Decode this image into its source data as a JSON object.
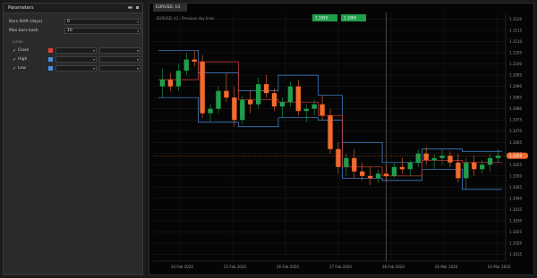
{
  "panel": {
    "title": "Parameters",
    "params": [
      {
        "label": "Bars Shift (days)",
        "value": "0"
      },
      {
        "label": "Max bars back",
        "value": "10"
      }
    ],
    "group": "Lines",
    "lines": [
      {
        "name": "Close",
        "color": "#e04040"
      },
      {
        "name": "High",
        "color": "#4a8fe0"
      },
      {
        "name": "Low",
        "color": "#4a8fe0"
      }
    ]
  },
  "chart": {
    "tab": "EURUSD, h1",
    "legend": "EURUSD, h1 · Previous day lines",
    "buy_price": "1.1060",
    "sell_price": "1.1059",
    "current_price": "1.1059",
    "x_labels": [
      "24 Feb 2020",
      "25 Feb 2020",
      "26 Feb 2020",
      "27 Feb 2020",
      "28 Feb 2020",
      "02 Mar 2020",
      "03 Mar 2020"
    ],
    "y_labels": [
      "1.1120",
      "1.1115",
      "1.1110",
      "1.1105",
      "1.1100",
      "1.1095",
      "1.1090",
      "1.1085",
      "1.1080",
      "1.1075",
      "1.1070",
      "1.1065",
      "1.1060",
      "1.1055",
      "1.1050",
      "1.1045",
      "1.1040",
      "1.1035",
      "1.1030",
      "1.1025",
      "1.1020",
      "1.1015"
    ],
    "colors": {
      "bull": "#1f9e4c",
      "bear": "#f26a2e",
      "line_close": "#e04040",
      "line_hl": "#4a8fe0",
      "price_tag": "#f26a2e"
    }
  },
  "chart_data": {
    "type": "candlestick",
    "candles": [
      {
        "o": 1.109,
        "h": 1.1098,
        "l": 1.1085,
        "c": 1.1093
      },
      {
        "o": 1.1093,
        "h": 1.1096,
        "l": 1.1088,
        "c": 1.109
      },
      {
        "o": 1.109,
        "h": 1.11,
        "l": 1.1088,
        "c": 1.1097
      },
      {
        "o": 1.1097,
        "h": 1.1105,
        "l": 1.1095,
        "c": 1.1102
      },
      {
        "o": 1.1102,
        "h": 1.1106,
        "l": 1.1099,
        "c": 1.1101
      },
      {
        "o": 1.1101,
        "h": 1.1104,
        "l": 1.1076,
        "c": 1.1078
      },
      {
        "o": 1.1078,
        "h": 1.1082,
        "l": 1.1074,
        "c": 1.108
      },
      {
        "o": 1.108,
        "h": 1.109,
        "l": 1.1078,
        "c": 1.1088
      },
      {
        "o": 1.1088,
        "h": 1.1096,
        "l": 1.1083,
        "c": 1.1085
      },
      {
        "o": 1.1085,
        "h": 1.109,
        "l": 1.1072,
        "c": 1.1075
      },
      {
        "o": 1.1075,
        "h": 1.1086,
        "l": 1.1073,
        "c": 1.1084
      },
      {
        "o": 1.1084,
        "h": 1.1088,
        "l": 1.1078,
        "c": 1.1082
      },
      {
        "o": 1.1082,
        "h": 1.1094,
        "l": 1.108,
        "c": 1.1091
      },
      {
        "o": 1.1091,
        "h": 1.1095,
        "l": 1.1085,
        "c": 1.1087
      },
      {
        "o": 1.1087,
        "h": 1.1089,
        "l": 1.1079,
        "c": 1.1081
      },
      {
        "o": 1.1081,
        "h": 1.1085,
        "l": 1.1076,
        "c": 1.1083
      },
      {
        "o": 1.1083,
        "h": 1.1092,
        "l": 1.1081,
        "c": 1.109
      },
      {
        "o": 1.109,
        "h": 1.1093,
        "l": 1.1077,
        "c": 1.1079
      },
      {
        "o": 1.1079,
        "h": 1.1082,
        "l": 1.1074,
        "c": 1.108
      },
      {
        "o": 1.108,
        "h": 1.1084,
        "l": 1.1077,
        "c": 1.1082
      },
      {
        "o": 1.1082,
        "h": 1.1086,
        "l": 1.1075,
        "c": 1.1077
      },
      {
        "o": 1.1077,
        "h": 1.108,
        "l": 1.106,
        "c": 1.1062
      },
      {
        "o": 1.1062,
        "h": 1.1065,
        "l": 1.1051,
        "c": 1.1054
      },
      {
        "o": 1.1054,
        "h": 1.106,
        "l": 1.105,
        "c": 1.1058
      },
      {
        "o": 1.1058,
        "h": 1.1062,
        "l": 1.1049,
        "c": 1.1052
      },
      {
        "o": 1.1052,
        "h": 1.1056,
        "l": 1.1048,
        "c": 1.105
      },
      {
        "o": 1.105,
        "h": 1.1054,
        "l": 1.1046,
        "c": 1.1049
      },
      {
        "o": 1.1049,
        "h": 1.1053,
        "l": 1.1047,
        "c": 1.1051
      },
      {
        "o": 1.1051,
        "h": 1.1055,
        "l": 1.1048,
        "c": 1.105
      },
      {
        "o": 1.105,
        "h": 1.1056,
        "l": 1.1049,
        "c": 1.1054
      },
      {
        "o": 1.1054,
        "h": 1.1058,
        "l": 1.1051,
        "c": 1.1053
      },
      {
        "o": 1.1053,
        "h": 1.1057,
        "l": 1.105,
        "c": 1.1056
      },
      {
        "o": 1.1056,
        "h": 1.1062,
        "l": 1.1054,
        "c": 1.106
      },
      {
        "o": 1.106,
        "h": 1.1063,
        "l": 1.1055,
        "c": 1.1057
      },
      {
        "o": 1.1057,
        "h": 1.106,
        "l": 1.1053,
        "c": 1.1058
      },
      {
        "o": 1.1058,
        "h": 1.1062,
        "l": 1.1055,
        "c": 1.1059
      },
      {
        "o": 1.1059,
        "h": 1.1061,
        "l": 1.1054,
        "c": 1.1056
      },
      {
        "o": 1.1056,
        "h": 1.106,
        "l": 1.1047,
        "c": 1.1049
      },
      {
        "o": 1.1049,
        "h": 1.1058,
        "l": 1.1044,
        "c": 1.1056
      },
      {
        "o": 1.1056,
        "h": 1.1059,
        "l": 1.105,
        "c": 1.1053
      },
      {
        "o": 1.1053,
        "h": 1.1057,
        "l": 1.1051,
        "c": 1.1055
      },
      {
        "o": 1.1055,
        "h": 1.106,
        "l": 1.1052,
        "c": 1.1058
      },
      {
        "o": 1.1058,
        "h": 1.1062,
        "l": 1.1056,
        "c": 1.1059
      }
    ],
    "close_line": [
      1.1093,
      1.1093,
      1.1093,
      1.1093,
      1.1093,
      1.1101,
      1.1101,
      1.1101,
      1.1101,
      1.1101,
      1.1084,
      1.1084,
      1.1084,
      1.1084,
      1.1084,
      1.1083,
      1.1083,
      1.1083,
      1.1083,
      1.1083,
      1.1077,
      1.1077,
      1.1077,
      1.1054,
      1.1054,
      1.1054,
      1.1054,
      1.1054,
      1.105,
      1.105,
      1.105,
      1.105,
      1.105,
      1.1057,
      1.1057,
      1.1057,
      1.1057,
      1.1057,
      1.1056,
      1.1056,
      1.1056,
      1.1056,
      1.1056
    ],
    "high_line": [
      1.1106,
      1.1106,
      1.1106,
      1.1106,
      1.1106,
      1.1096,
      1.1096,
      1.1096,
      1.1096,
      1.1096,
      1.1088,
      1.1088,
      1.1088,
      1.1088,
      1.1088,
      1.1095,
      1.1095,
      1.1095,
      1.1095,
      1.1095,
      1.1086,
      1.1086,
      1.1086,
      1.1065,
      1.1065,
      1.1065,
      1.1065,
      1.1065,
      1.1056,
      1.1056,
      1.1056,
      1.1056,
      1.1056,
      1.1062,
      1.1062,
      1.1062,
      1.1062,
      1.1062,
      1.1061,
      1.1061,
      1.1061,
      1.1061,
      1.1061
    ],
    "low_line": [
      1.1085,
      1.1085,
      1.1085,
      1.1085,
      1.1085,
      1.1074,
      1.1074,
      1.1074,
      1.1074,
      1.1074,
      1.1072,
      1.1072,
      1.1072,
      1.1072,
      1.1072,
      1.1076,
      1.1076,
      1.1076,
      1.1076,
      1.1076,
      1.1075,
      1.1075,
      1.1075,
      1.1049,
      1.1049,
      1.1049,
      1.1049,
      1.1049,
      1.1048,
      1.1048,
      1.1048,
      1.1048,
      1.1048,
      1.1053,
      1.1053,
      1.1053,
      1.1053,
      1.1053,
      1.1044,
      1.1044,
      1.1044,
      1.1044,
      1.1044
    ],
    "ylim": [
      1.1012,
      1.1123
    ],
    "grid": true
  }
}
